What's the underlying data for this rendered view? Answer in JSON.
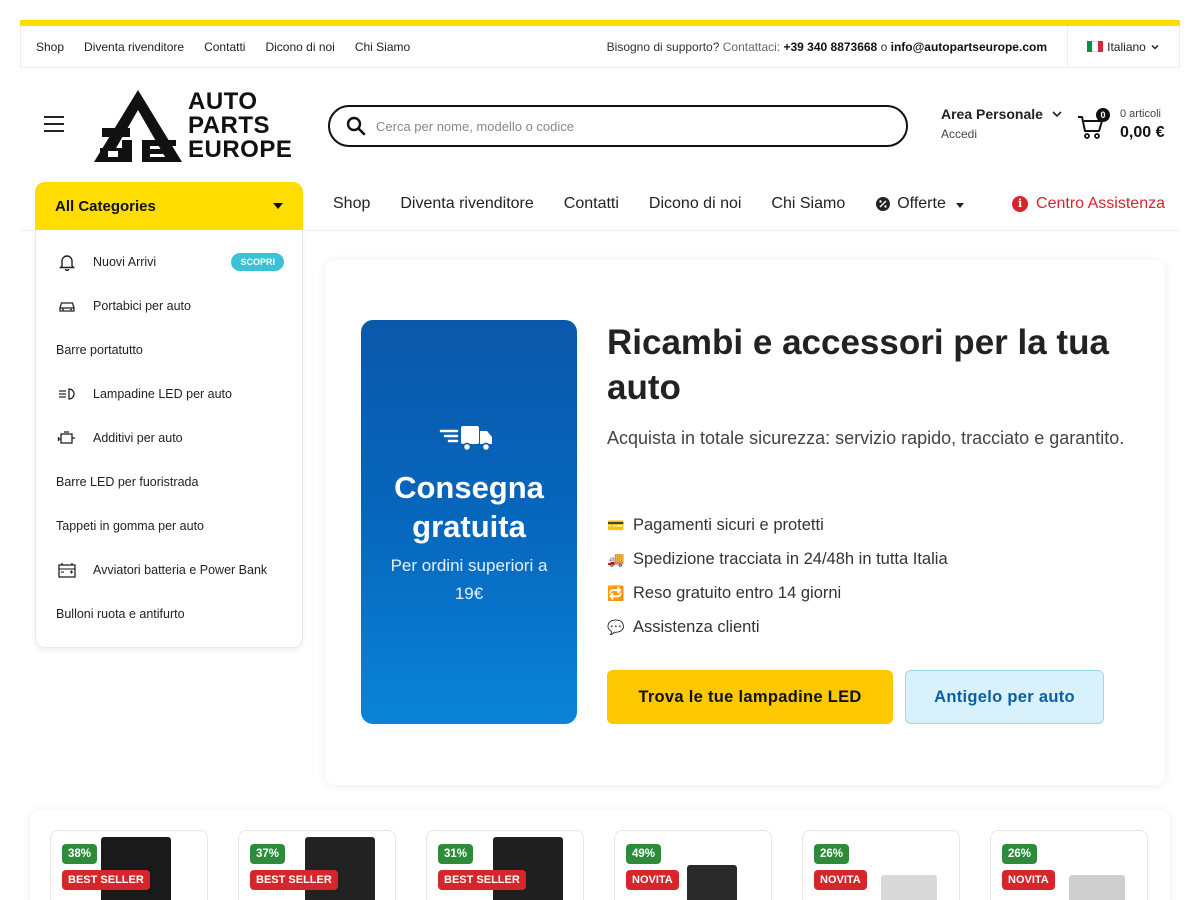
{
  "topbar": {
    "links": [
      "Shop",
      "Diventa rivenditore",
      "Contatti",
      "Dicono di noi",
      "Chi Siamo"
    ],
    "support_label": "Bisogno di supporto?",
    "contact_label": "Contattaci:",
    "phone": "+39 340 8873668",
    "or": "o",
    "email": "info@autopartseurope.com",
    "language": "Italiano"
  },
  "header": {
    "logo_lines": [
      "AUTO",
      "PARTS",
      "EUROPE"
    ],
    "search_placeholder": "Cerca per nome, modello o codice",
    "account_title": "Area Personale",
    "account_sub": "Accedi",
    "cart_badge": "0",
    "cart_count": "0 articoli",
    "cart_total": "0,00 €"
  },
  "nav": {
    "all_categories": "All Categories",
    "items": [
      "Shop",
      "Diventa rivenditore",
      "Contatti",
      "Dicono di noi",
      "Chi Siamo"
    ],
    "offers": "Offerte",
    "help": "Centro Assistenza"
  },
  "categories": [
    {
      "label": "Nuovi Arrivi",
      "icon": "bell-icon",
      "pill": "SCOPRI"
    },
    {
      "label": "Portabici per auto",
      "icon": "car-icon"
    },
    {
      "label": "Barre portatutto",
      "icon": ""
    },
    {
      "label": "Lampadine LED per auto",
      "icon": "headlight-icon"
    },
    {
      "label": "Additivi per auto",
      "icon": "engine-icon"
    },
    {
      "label": "Barre LED per fuoristrada",
      "icon": ""
    },
    {
      "label": "Tappeti in gomma per auto",
      "icon": ""
    },
    {
      "label": "Avviatori batteria e Power Bank",
      "icon": "battery-icon"
    },
    {
      "label": "Bulloni ruota e antifurto",
      "icon": ""
    }
  ],
  "hero": {
    "promo_title_1": "Consegna",
    "promo_title_2": "gratuita",
    "promo_sub": "Per ordini superiori a 19€",
    "title": "Ricambi e accessori per la tua auto",
    "lead": "Acquista in totale sicurezza: servizio rapido, tracciato e garantito.",
    "features": [
      {
        "emoji": "💳",
        "text": "Pagamenti sicuri e protetti"
      },
      {
        "emoji": "🚚",
        "text": "Spedizione tracciata in 24/48h in tutta Italia"
      },
      {
        "emoji": "🔁",
        "text": "Reso gratuito entro 14 giorni"
      },
      {
        "emoji": "💬",
        "text": "Assistenza clienti"
      }
    ],
    "cta_primary": "Trova le tue lampadine LED",
    "cta_secondary": "Antigelo per auto"
  },
  "products": [
    {
      "discount": "38%",
      "tag": "BEST SELLER",
      "box_color": "#1a1a1a"
    },
    {
      "discount": "37%",
      "tag": "BEST SELLER",
      "box_color": "#222222"
    },
    {
      "discount": "31%",
      "tag": "BEST SELLER",
      "box_color": "#1f1f1f"
    },
    {
      "discount": "49%",
      "tag": "NOVITA",
      "box_color": "#2a2a2a"
    },
    {
      "discount": "26%",
      "tag": "NOVITA",
      "box_color": "#d9d9d9"
    },
    {
      "discount": "26%",
      "tag": "NOVITA",
      "box_color": "#cfcfcf"
    }
  ],
  "colors": {
    "brand_yellow": "#ffdd00",
    "cta_yellow": "#fdc800",
    "help_red": "#d7262b",
    "discount_green": "#2e8b3a",
    "promo_blue": "#0667bd"
  }
}
